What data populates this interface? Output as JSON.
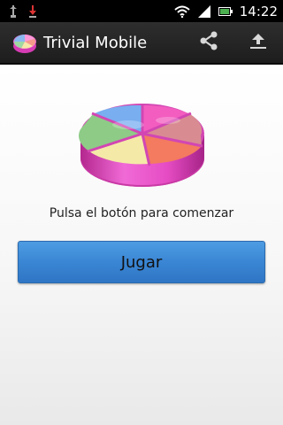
{
  "status_bar": {
    "time": "14:22",
    "icons": [
      "usb-icon",
      "download-icon",
      "wifi-icon",
      "signal-icon",
      "battery-icon"
    ]
  },
  "action_bar": {
    "title": "Trivial Mobile",
    "actions": [
      "share-icon",
      "upload-icon"
    ]
  },
  "main": {
    "prompt": "Pulsa el botón para comenzar",
    "play_button_label": "Jugar"
  },
  "colors": {
    "action_bar": "#262626",
    "button_blue": "#3a86d4",
    "logo_base": "#e03fbf"
  }
}
